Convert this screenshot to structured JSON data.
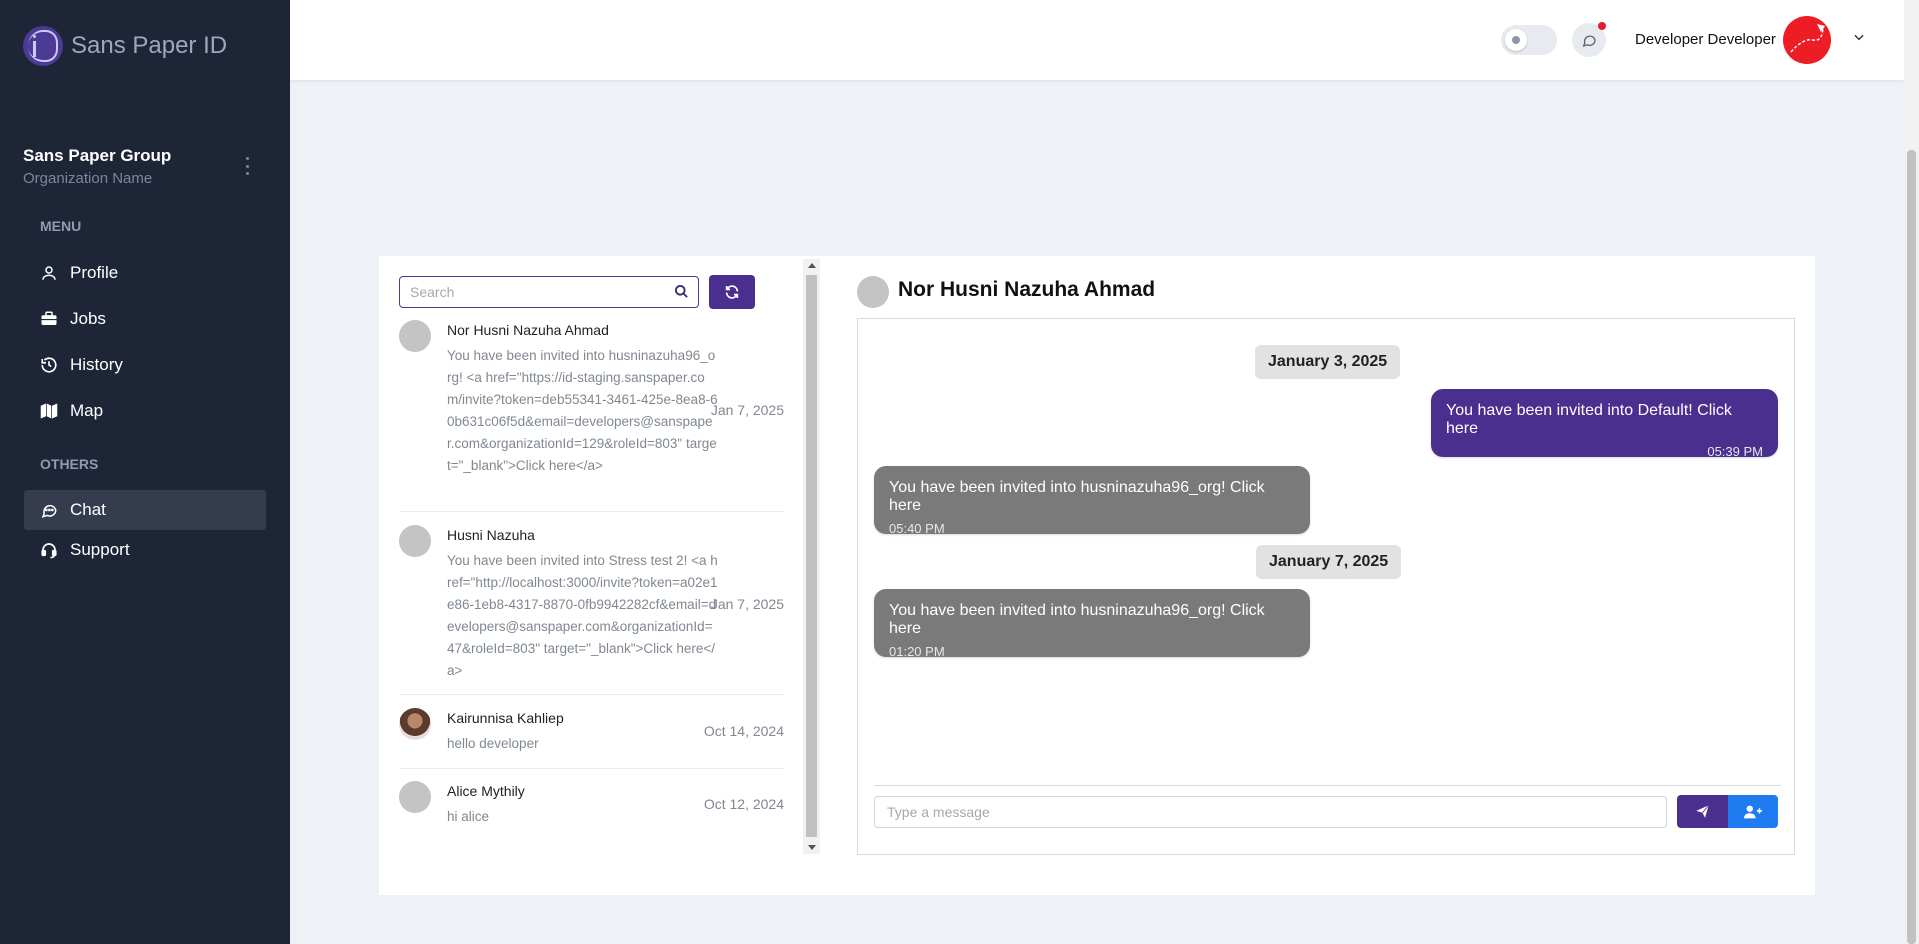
{
  "brand": {
    "name": "Sans Paper ID"
  },
  "org": {
    "name": "Sans Paper Group",
    "subtitle": "Organization Name"
  },
  "sidebar": {
    "menu_title": "MENU",
    "others_title": "OTHERS",
    "items": [
      {
        "label": "Profile",
        "icon": "user-icon"
      },
      {
        "label": "Jobs",
        "icon": "briefcase-icon"
      },
      {
        "label": "History",
        "icon": "history-icon"
      },
      {
        "label": "Map",
        "icon": "map-icon"
      },
      {
        "label": "Chat",
        "icon": "chat-icon",
        "active": true
      },
      {
        "label": "Support",
        "icon": "headset-icon"
      }
    ]
  },
  "header": {
    "user_name": "Developer Developer",
    "notification_badge_color": "#e11d2e"
  },
  "search": {
    "placeholder": "Search"
  },
  "conversations": [
    {
      "name": "Nor Husni Nazuha Ahmad",
      "preview": "You have been invited into husninazuha96_org! <a href=\"https://id-staging.sanspaper.com/invite?token=deb55341-3461-425e-8ea8-60b631c06f5d&email=developers@sanspaper.com&organizationId=129&roleId=803\" target=\"_blank\">Click here</a>",
      "date": "Jan 7, 2025"
    },
    {
      "name": "Husni Nazuha",
      "preview": "You have been invited into Stress test 2! <a href=\"http://localhost:3000/invite?token=a02e1e86-1eb8-4317-8870-0fb9942282cf&email=developers@sanspaper.com&organizationId=47&roleId=803\" target=\"_blank\">Click here</a>",
      "date": "Jan 7, 2025"
    },
    {
      "name": "Kairunnisa Kahliep",
      "preview": "hello developer",
      "date": "Oct 14, 2024"
    },
    {
      "name": "Alice Mythily",
      "preview": "hi alice",
      "date": "Oct 12, 2024"
    }
  ],
  "chat": {
    "title": "Nor Husni Nazuha Ahmad",
    "date_1": "January 3, 2025",
    "date_2": "January 7, 2025",
    "messages": [
      {
        "text": "You have been invited into Default! Click here",
        "time": "05:39 PM",
        "direction": "outgoing"
      },
      {
        "text": "You have been invited into husninazuha96_org! Click here",
        "time": "05:40 PM",
        "direction": "incoming"
      },
      {
        "text": "You have been invited into husninazuha96_org! Click here",
        "time": "01:20 PM",
        "direction": "incoming"
      }
    ],
    "composer_placeholder": "Type a message"
  },
  "colors": {
    "sidebar": "#1e2537",
    "primary": "#4b2f8f",
    "incoming_bubble": "#7a7a7a",
    "add_user": "#1e7bf0"
  }
}
